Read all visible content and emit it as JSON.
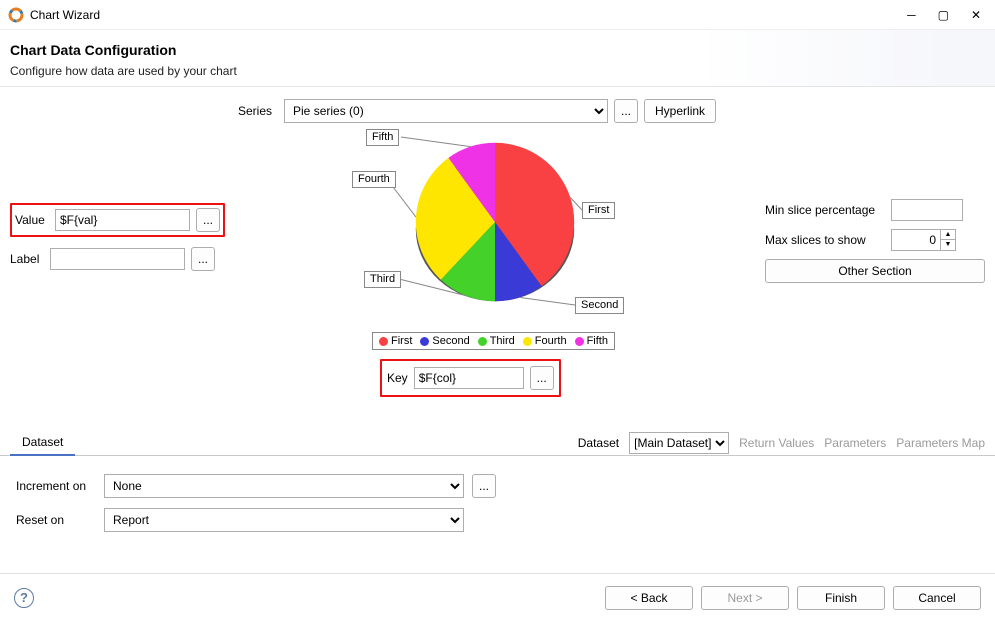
{
  "window": {
    "title": "Chart Wizard",
    "min": "—",
    "max": "▢",
    "close": "✕"
  },
  "header": {
    "title": "Chart Data Configuration",
    "subtitle": "Configure how data are used by your chart"
  },
  "series": {
    "label": "Series",
    "selected": "Pie series (0)",
    "more": "...",
    "hyperlink": "Hyperlink"
  },
  "fields": {
    "value_label": "Value",
    "value": "$F{val}",
    "value_more": "...",
    "label_label": "Label",
    "label": "",
    "label_more": "...",
    "key_label": "Key",
    "key": "$F{col}",
    "key_more": "..."
  },
  "right": {
    "min_pct_label": "Min slice percentage",
    "min_pct": "",
    "max_slices_label": "Max slices to show",
    "max_slices": "0",
    "other_section": "Other Section"
  },
  "tabs": {
    "dataset": "Dataset"
  },
  "dataset_bar": {
    "label": "Dataset",
    "selected": "[Main Dataset]",
    "return_values": "Return Values",
    "parameters": "Parameters",
    "parameters_map": "Parameters Map"
  },
  "form": {
    "increment_label": "Increment on",
    "increment": "None",
    "increment_more": "...",
    "reset_label": "Reset on",
    "reset": "Report"
  },
  "footer": {
    "help": "?",
    "back": "< Back",
    "next": "Next >",
    "finish": "Finish",
    "cancel": "Cancel"
  },
  "chart_data": {
    "type": "pie",
    "title": "",
    "categories": [
      "First",
      "Second",
      "Third",
      "Fourth",
      "Fifth"
    ],
    "values": [
      40,
      10,
      12,
      28,
      10
    ],
    "colors": [
      "#f94144",
      "#3a3ad6",
      "#43d12a",
      "#ffe600",
      "#f032e6"
    ],
    "legend": [
      "First",
      "Second",
      "Third",
      "Fourth",
      "Fifth"
    ],
    "legend_position": "bottom"
  }
}
